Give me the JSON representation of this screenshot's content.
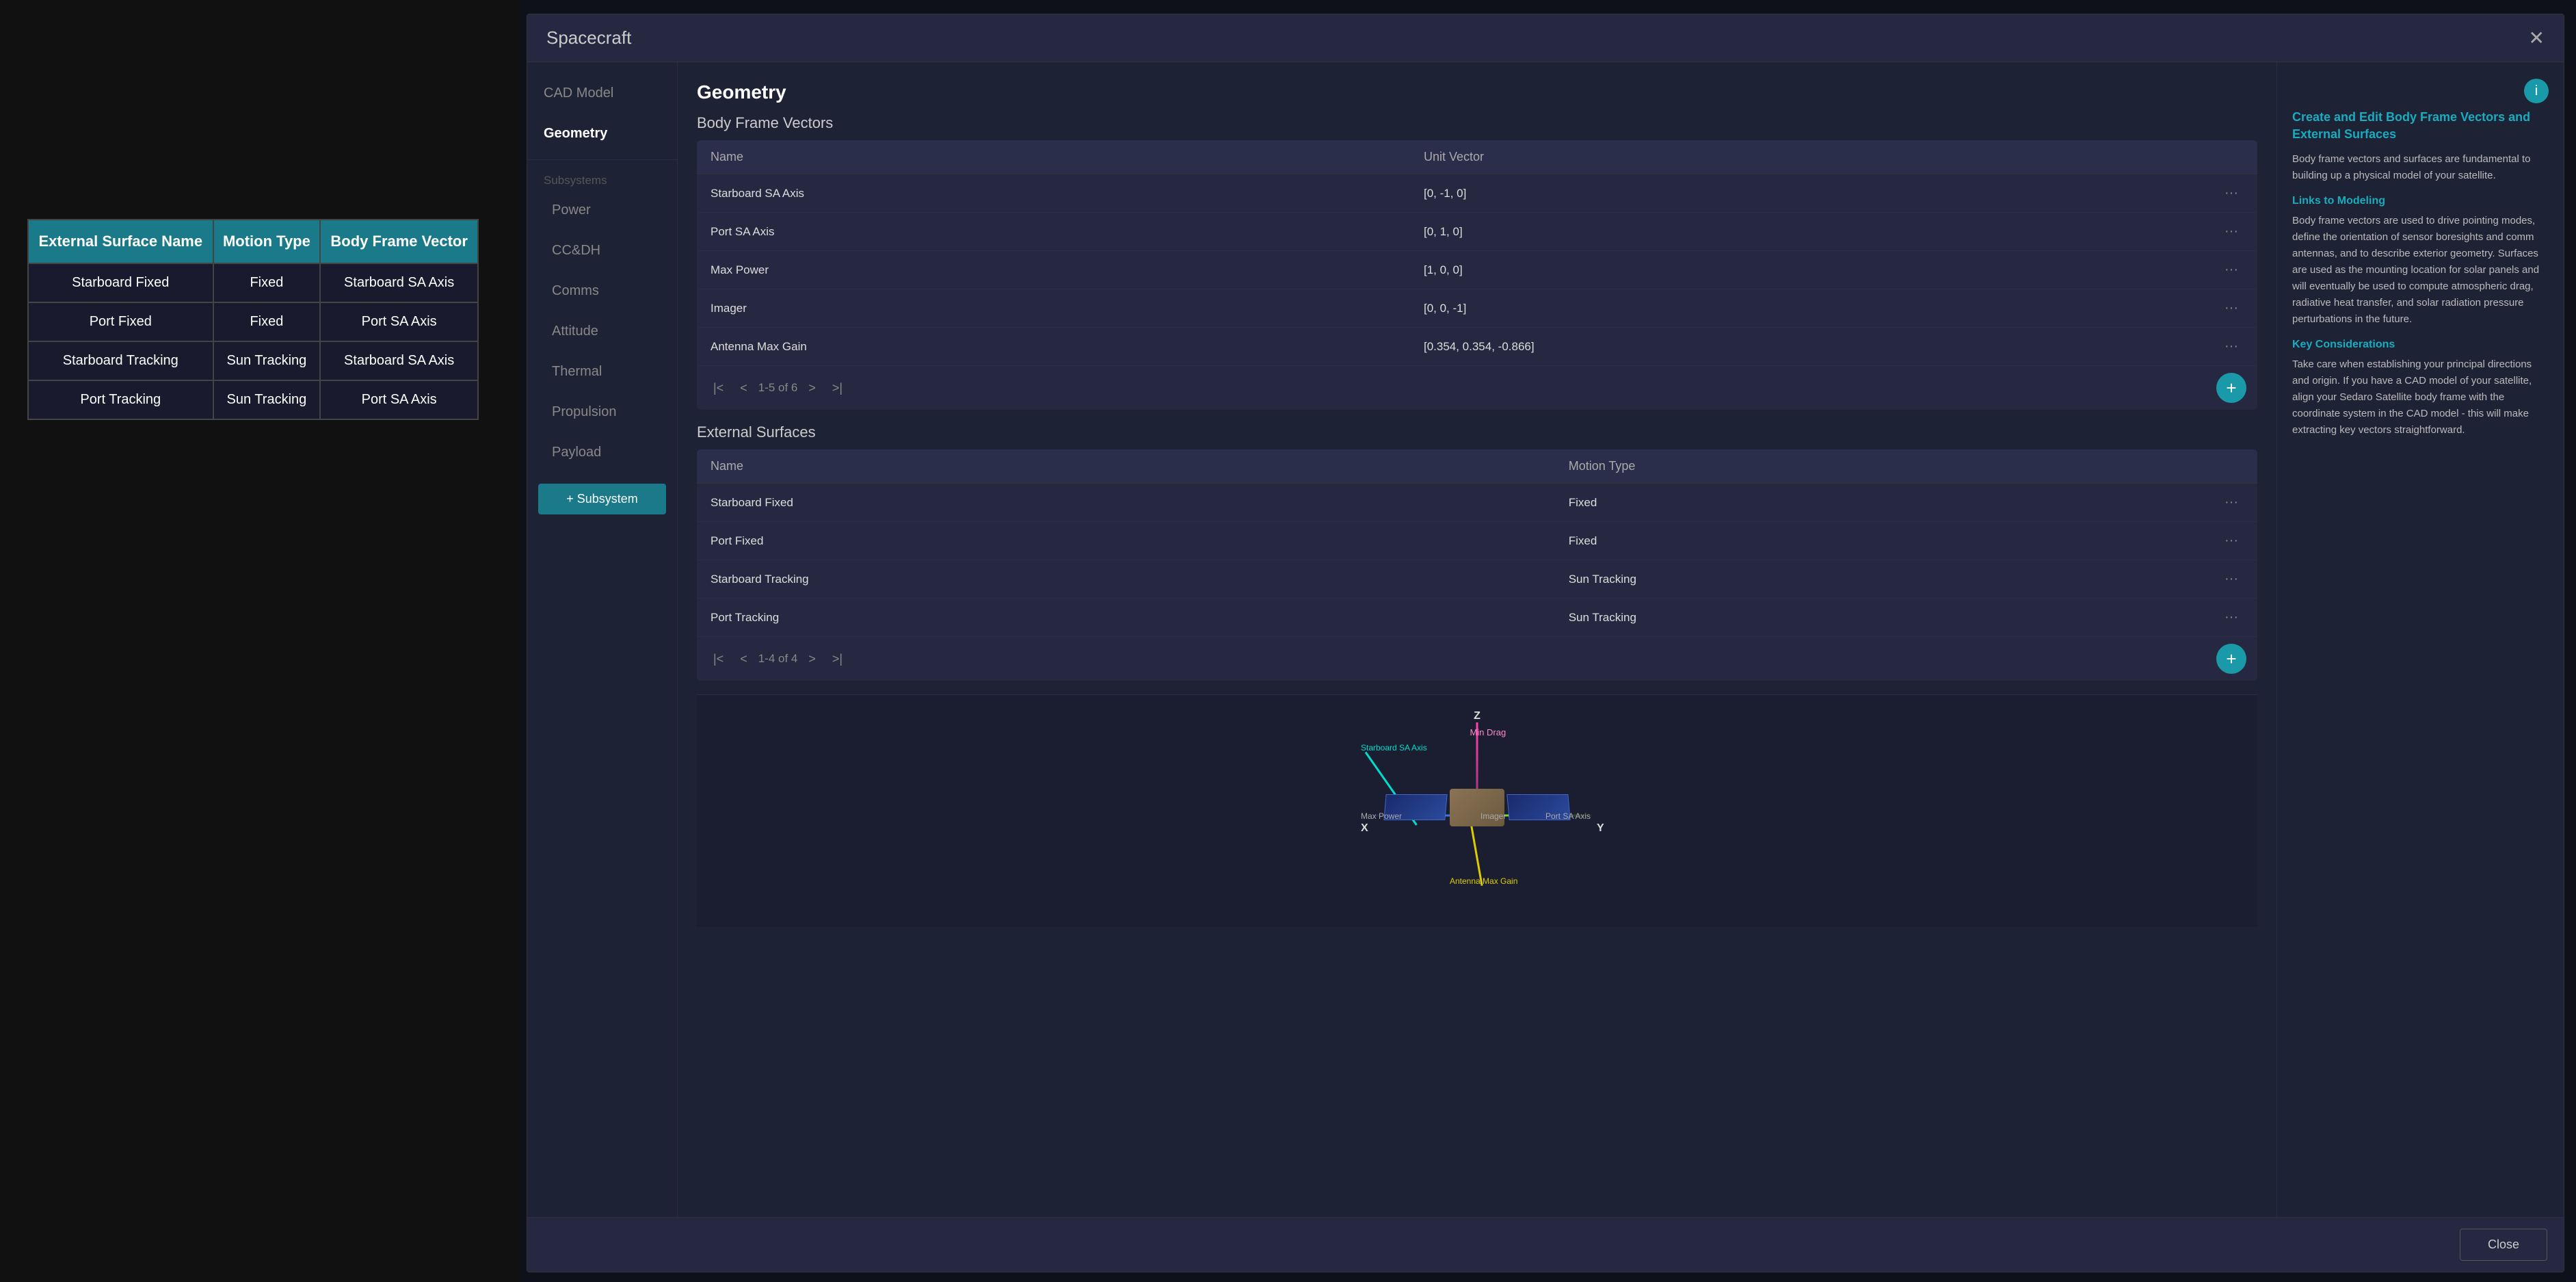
{
  "leftTable": {
    "columns": [
      "External Surface Name",
      "Motion Type",
      "Body Frame Vector"
    ],
    "rows": [
      [
        "Starboard Fixed",
        "Fixed",
        "Starboard SA Axis"
      ],
      [
        "Port Fixed",
        "Fixed",
        "Port SA Axis"
      ],
      [
        "Starboard Tracking",
        "Sun Tracking",
        "Starboard SA Axis"
      ],
      [
        "Port Tracking",
        "Sun Tracking",
        "Port SA Axis"
      ]
    ]
  },
  "modal": {
    "title": "Spacecraft",
    "close_label": "✕",
    "sidebar": {
      "items": [
        {
          "label": "CAD Model",
          "active": false,
          "indented": false
        },
        {
          "label": "Geometry",
          "active": true,
          "indented": false
        },
        {
          "label": "Subsystems",
          "active": false,
          "indented": false,
          "divider": true
        },
        {
          "label": "Power",
          "active": false,
          "indented": true
        },
        {
          "label": "CC&DH",
          "active": false,
          "indented": true
        },
        {
          "label": "Comms",
          "active": false,
          "indented": true
        },
        {
          "label": "Attitude",
          "active": false,
          "indented": true
        },
        {
          "label": "Thermal",
          "active": false,
          "indented": true
        },
        {
          "label": "Propulsion",
          "active": false,
          "indented": true
        },
        {
          "label": "Payload",
          "active": false,
          "indented": true
        }
      ],
      "add_subsystem": "+ Subsystem"
    },
    "geometry": {
      "title": "Geometry",
      "bodyFrameVectors": {
        "title": "Body Frame Vectors",
        "columns": [
          "Name",
          "Unit Vector"
        ],
        "rows": [
          {
            "name": "Starboard SA Axis",
            "vector": "[0, -1, 0]"
          },
          {
            "name": "Port SA Axis",
            "vector": "[0, 1, 0]"
          },
          {
            "name": "Max Power",
            "vector": "[1, 0, 0]"
          },
          {
            "name": "Imager",
            "vector": "[0, 0, -1]"
          },
          {
            "name": "Antenna Max Gain",
            "vector": "[0.354, 0.354, -0.866]"
          }
        ],
        "pagination": "1-5 of 6"
      },
      "externalSurfaces": {
        "title": "External Surfaces",
        "columns": [
          "Name",
          "Motion Type"
        ],
        "rows": [
          {
            "name": "Starboard Fixed",
            "motionType": "Fixed"
          },
          {
            "name": "Port Fixed",
            "motionType": "Fixed"
          },
          {
            "name": "Starboard Tracking",
            "motionType": "Sun Tracking"
          },
          {
            "name": "Port Tracking",
            "motionType": "Sun Tracking"
          }
        ],
        "pagination": "1-4 of 4"
      }
    },
    "infoPanel": {
      "mainTitle": "Create and Edit Body Frame Vectors and External Surfaces",
      "bodyText1": "Body frame vectors and surfaces are fundamental to building up a physical model of your satellite.",
      "linkToModeling": "Links to Modeling",
      "bodyText2": "Body frame vectors are used to drive pointing modes, define the orientation of sensor boresights and comm antennas, and to describe exterior geometry. Surfaces are used as the mounting location for solar panels and will eventually be used to compute atmospheric drag, radiative heat transfer, and solar radiation pressure perturbations in the future.",
      "keyConsiderations": "Key Considerations",
      "bodyText3": "Take care when establishing your principal directions and origin. If you have a CAD model of your satellite, align your Sedaro Satellite body frame with the coordinate system in the CAD model - this will make extracting key vectors straightforward."
    },
    "viz": {
      "axisLabels": {
        "z": "Z",
        "minDrag": "Min Drag",
        "x": "X",
        "y": "Y",
        "maxPower": "Max Power",
        "imager": "Imager",
        "portSAAxis": "Port SA Axis",
        "starboardSAAxis": "Starboard SA Axis",
        "antennaMaxGain": "Antenna Max Gain"
      }
    },
    "closeButton": "Close"
  }
}
